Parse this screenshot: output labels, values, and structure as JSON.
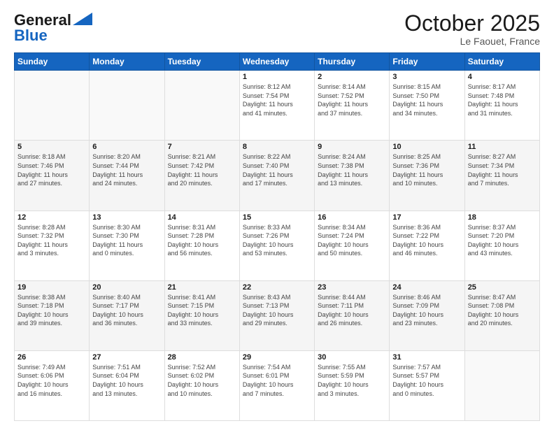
{
  "header": {
    "logo_general": "General",
    "logo_blue": "Blue",
    "month_title": "October 2025",
    "location": "Le Faouet, France"
  },
  "days_of_week": [
    "Sunday",
    "Monday",
    "Tuesday",
    "Wednesday",
    "Thursday",
    "Friday",
    "Saturday"
  ],
  "weeks": [
    [
      {
        "day": "",
        "info": ""
      },
      {
        "day": "",
        "info": ""
      },
      {
        "day": "",
        "info": ""
      },
      {
        "day": "1",
        "info": "Sunrise: 8:12 AM\nSunset: 7:54 PM\nDaylight: 11 hours\nand 41 minutes."
      },
      {
        "day": "2",
        "info": "Sunrise: 8:14 AM\nSunset: 7:52 PM\nDaylight: 11 hours\nand 37 minutes."
      },
      {
        "day": "3",
        "info": "Sunrise: 8:15 AM\nSunset: 7:50 PM\nDaylight: 11 hours\nand 34 minutes."
      },
      {
        "day": "4",
        "info": "Sunrise: 8:17 AM\nSunset: 7:48 PM\nDaylight: 11 hours\nand 31 minutes."
      }
    ],
    [
      {
        "day": "5",
        "info": "Sunrise: 8:18 AM\nSunset: 7:46 PM\nDaylight: 11 hours\nand 27 minutes."
      },
      {
        "day": "6",
        "info": "Sunrise: 8:20 AM\nSunset: 7:44 PM\nDaylight: 11 hours\nand 24 minutes."
      },
      {
        "day": "7",
        "info": "Sunrise: 8:21 AM\nSunset: 7:42 PM\nDaylight: 11 hours\nand 20 minutes."
      },
      {
        "day": "8",
        "info": "Sunrise: 8:22 AM\nSunset: 7:40 PM\nDaylight: 11 hours\nand 17 minutes."
      },
      {
        "day": "9",
        "info": "Sunrise: 8:24 AM\nSunset: 7:38 PM\nDaylight: 11 hours\nand 13 minutes."
      },
      {
        "day": "10",
        "info": "Sunrise: 8:25 AM\nSunset: 7:36 PM\nDaylight: 11 hours\nand 10 minutes."
      },
      {
        "day": "11",
        "info": "Sunrise: 8:27 AM\nSunset: 7:34 PM\nDaylight: 11 hours\nand 7 minutes."
      }
    ],
    [
      {
        "day": "12",
        "info": "Sunrise: 8:28 AM\nSunset: 7:32 PM\nDaylight: 11 hours\nand 3 minutes."
      },
      {
        "day": "13",
        "info": "Sunrise: 8:30 AM\nSunset: 7:30 PM\nDaylight: 11 hours\nand 0 minutes."
      },
      {
        "day": "14",
        "info": "Sunrise: 8:31 AM\nSunset: 7:28 PM\nDaylight: 10 hours\nand 56 minutes."
      },
      {
        "day": "15",
        "info": "Sunrise: 8:33 AM\nSunset: 7:26 PM\nDaylight: 10 hours\nand 53 minutes."
      },
      {
        "day": "16",
        "info": "Sunrise: 8:34 AM\nSunset: 7:24 PM\nDaylight: 10 hours\nand 50 minutes."
      },
      {
        "day": "17",
        "info": "Sunrise: 8:36 AM\nSunset: 7:22 PM\nDaylight: 10 hours\nand 46 minutes."
      },
      {
        "day": "18",
        "info": "Sunrise: 8:37 AM\nSunset: 7:20 PM\nDaylight: 10 hours\nand 43 minutes."
      }
    ],
    [
      {
        "day": "19",
        "info": "Sunrise: 8:38 AM\nSunset: 7:18 PM\nDaylight: 10 hours\nand 39 minutes."
      },
      {
        "day": "20",
        "info": "Sunrise: 8:40 AM\nSunset: 7:17 PM\nDaylight: 10 hours\nand 36 minutes."
      },
      {
        "day": "21",
        "info": "Sunrise: 8:41 AM\nSunset: 7:15 PM\nDaylight: 10 hours\nand 33 minutes."
      },
      {
        "day": "22",
        "info": "Sunrise: 8:43 AM\nSunset: 7:13 PM\nDaylight: 10 hours\nand 29 minutes."
      },
      {
        "day": "23",
        "info": "Sunrise: 8:44 AM\nSunset: 7:11 PM\nDaylight: 10 hours\nand 26 minutes."
      },
      {
        "day": "24",
        "info": "Sunrise: 8:46 AM\nSunset: 7:09 PM\nDaylight: 10 hours\nand 23 minutes."
      },
      {
        "day": "25",
        "info": "Sunrise: 8:47 AM\nSunset: 7:08 PM\nDaylight: 10 hours\nand 20 minutes."
      }
    ],
    [
      {
        "day": "26",
        "info": "Sunrise: 7:49 AM\nSunset: 6:06 PM\nDaylight: 10 hours\nand 16 minutes."
      },
      {
        "day": "27",
        "info": "Sunrise: 7:51 AM\nSunset: 6:04 PM\nDaylight: 10 hours\nand 13 minutes."
      },
      {
        "day": "28",
        "info": "Sunrise: 7:52 AM\nSunset: 6:02 PM\nDaylight: 10 hours\nand 10 minutes."
      },
      {
        "day": "29",
        "info": "Sunrise: 7:54 AM\nSunset: 6:01 PM\nDaylight: 10 hours\nand 7 minutes."
      },
      {
        "day": "30",
        "info": "Sunrise: 7:55 AM\nSunset: 5:59 PM\nDaylight: 10 hours\nand 3 minutes."
      },
      {
        "day": "31",
        "info": "Sunrise: 7:57 AM\nSunset: 5:57 PM\nDaylight: 10 hours\nand 0 minutes."
      },
      {
        "day": "",
        "info": ""
      }
    ]
  ]
}
